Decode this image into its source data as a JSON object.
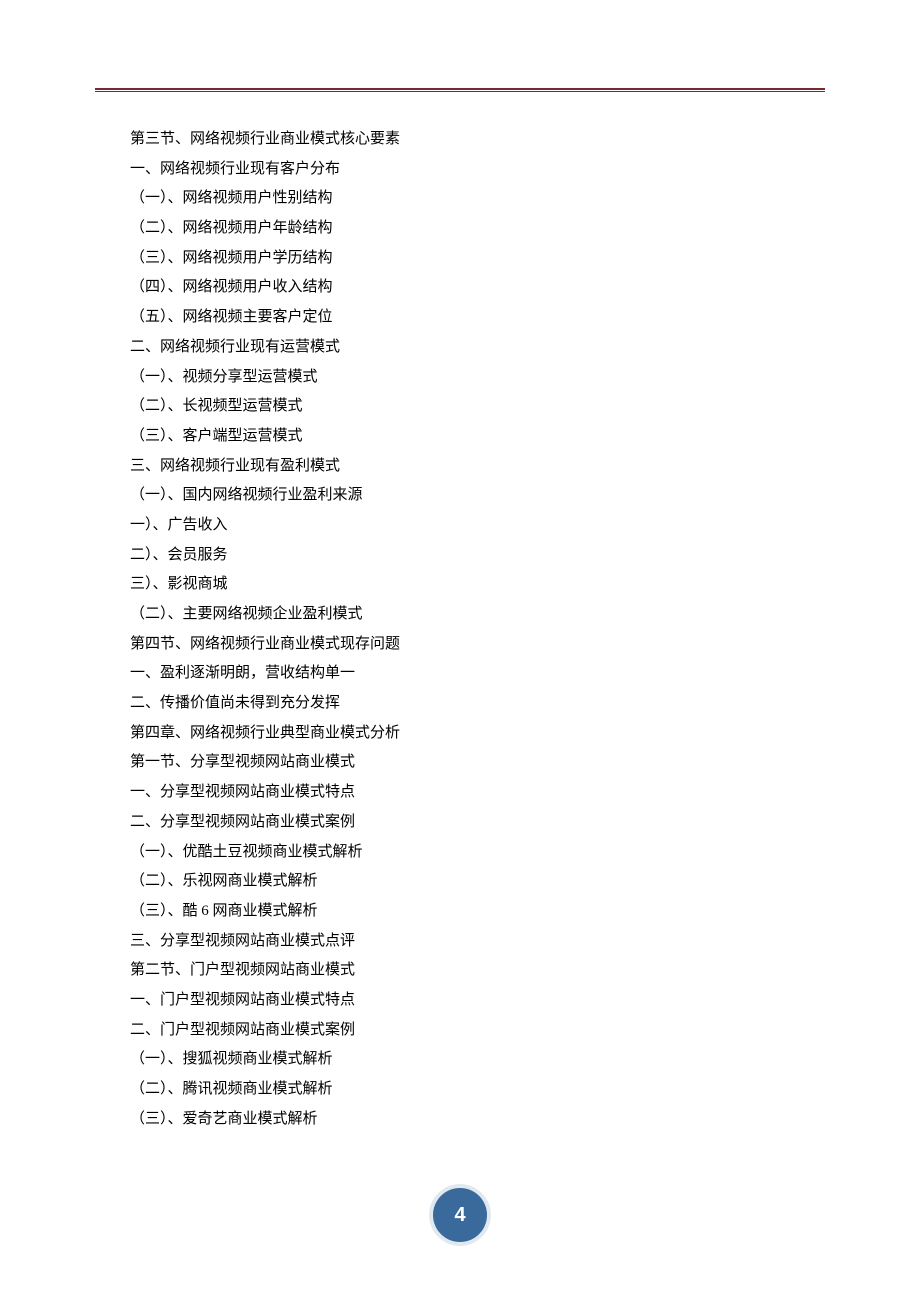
{
  "page_number": "4",
  "toc": [
    "第三节、网络视频行业商业模式核心要素",
    "一、网络视频行业现有客户分布",
    "（一）、网络视频用户性别结构",
    "（二）、网络视频用户年龄结构",
    "（三）、网络视频用户学历结构",
    "（四）、网络视频用户收入结构",
    "（五）、网络视频主要客户定位",
    "二、网络视频行业现有运营模式",
    "（一）、视频分享型运营模式",
    "（二）、长视频型运营模式",
    "（三）、客户端型运营模式",
    "三、网络视频行业现有盈利模式",
    "（一）、国内网络视频行业盈利来源",
    "一）、广告收入",
    "二）、会员服务",
    "三）、影视商城",
    "（二）、主要网络视频企业盈利模式",
    "第四节、网络视频行业商业模式现存问题",
    "一、盈利逐渐明朗，营收结构单一",
    "二、传播价值尚未得到充分发挥",
    "第四章、网络视频行业典型商业模式分析",
    "第一节、分享型视频网站商业模式",
    "一、分享型视频网站商业模式特点",
    "二、分享型视频网站商业模式案例",
    "（一）、优酷土豆视频商业模式解析",
    "（二）、乐视网商业模式解析",
    "（三）、酷 6 网商业模式解析",
    "三、分享型视频网站商业模式点评",
    "第二节、门户型视频网站商业模式",
    "一、门户型视频网站商业模式特点",
    "二、门户型视频网站商业模式案例",
    "（一）、搜狐视频商业模式解析",
    "（二）、腾讯视频商业模式解析",
    "（三）、爱奇艺商业模式解析"
  ]
}
